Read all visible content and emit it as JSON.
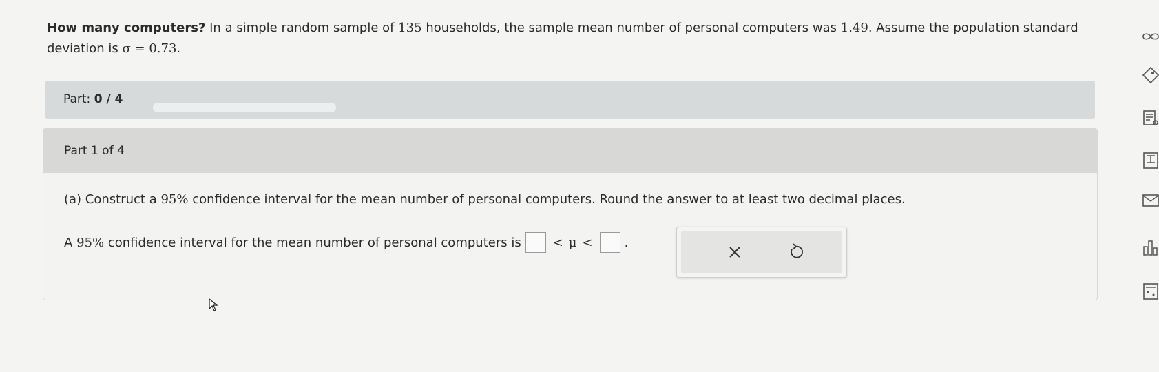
{
  "question": {
    "title": "How many computers?",
    "text_1": "In a simple random sample of",
    "n": "135",
    "text_2": "households, the sample mean number of personal computers was",
    "mean": "1.49",
    "text_3": ". Assume the population standard deviation is",
    "sigma_expr": "σ = 0.73",
    "end": "."
  },
  "progress": {
    "label": "Part:",
    "value": "0 / 4",
    "fraction": 0
  },
  "part": {
    "header": "Part 1 of 4",
    "prompt_prefix": "(a) Construct a",
    "percent": "95%",
    "prompt_rest": "confidence interval for the mean number of personal computers. Round the answer to at least two decimal places.",
    "answer_prefix": "A",
    "answer_rest": "confidence interval for the mean number of personal computers is",
    "lt1": "<",
    "mu": "μ",
    "lt2": "<",
    "period": "."
  },
  "actions": {
    "clear_icon": "x-icon",
    "undo_icon": "undo-icon"
  },
  "toolbar": {
    "icons": [
      "infinity-icon",
      "tag-icon",
      "reader-icon",
      "book-icon",
      "mail-icon",
      "chart-icon",
      "calculator-icon"
    ]
  },
  "colors": {
    "progress_fill": "#5f9ec9",
    "panel_header": "#d8d8d6",
    "part_bar": "#d7dadb"
  }
}
